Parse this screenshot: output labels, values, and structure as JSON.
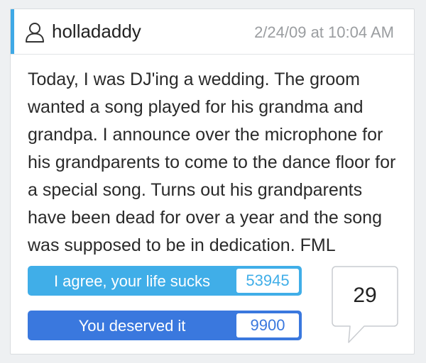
{
  "post": {
    "username": "holladaddy",
    "timestamp": "2/24/09 at 10:04 AM",
    "story": "Today, I was DJ'ing a wedding. The groom wanted a song played for his grandma and grandpa. I announce over the microphone for his grandparents to come to the dance floor for a special song. Turns out his grandparents have been dead for over a year and the song was supposed to be in dedication. FML"
  },
  "votes": {
    "agree": {
      "label": "I agree, your life sucks",
      "count": "53945"
    },
    "deserved": {
      "label": "You deserved it",
      "count": "9900"
    }
  },
  "comments": {
    "count": "29"
  },
  "colors": {
    "accent": "#3fa9e6",
    "agree": "#40aee8",
    "deserved": "#3a78de",
    "timestamp": "#9a9da0"
  },
  "icons": {
    "user": "user-outline-icon",
    "comment": "speech-bubble-icon"
  }
}
